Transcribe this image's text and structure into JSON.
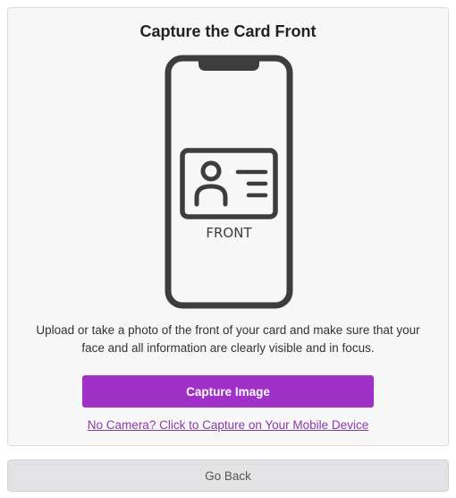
{
  "card": {
    "title": "Capture the Card Front",
    "illustration": {
      "card_label": "FRONT",
      "icons": [
        "phone-icon",
        "id-card-icon",
        "person-icon"
      ]
    },
    "instructions": "Upload or take a photo of the front of your card and make sure that your face and all information are clearly visible and in focus.",
    "capture_button_label": "Capture Image",
    "mobile_link_text": "No Camera? Click to Capture on Your Mobile Device"
  },
  "footer": {
    "back_button_label": "Go Back"
  },
  "colors": {
    "accent": "#a130c8",
    "link": "#8c3aa7",
    "icon_stroke": "#3d3d3d",
    "card_background": "#f7f7f8"
  }
}
